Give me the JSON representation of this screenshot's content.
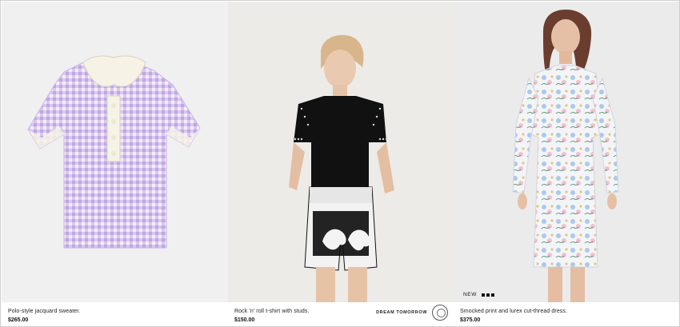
{
  "products": [
    {
      "name": "Polo-style jacquard sweater.",
      "price": "$265.00",
      "image_icon": "polo-sweater-image",
      "background": "#f1f1f1"
    },
    {
      "name": "Rock 'n' roll t-shirt with studs.",
      "price": "$150.00",
      "image_icon": "tshirt-shorts-model-image",
      "background": "#ececea",
      "brand_text": "DREAM TOMORROW"
    },
    {
      "name": "Smocked print and lurex cut-thread dress.",
      "price": "$375.00",
      "image_icon": "floral-dress-model-image",
      "background": "#ebebeb",
      "badge": "NEW"
    }
  ],
  "colors": {
    "lavender": "#c9b6e6",
    "cream": "#f4f1e3",
    "black": "#111111",
    "skin": "#e7c7ad"
  }
}
